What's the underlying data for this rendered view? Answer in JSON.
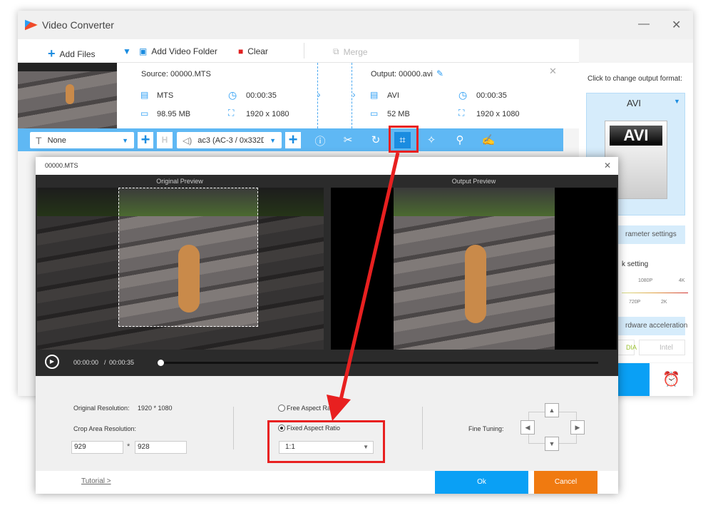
{
  "app": {
    "title": "Video Converter"
  },
  "toolbar": {
    "add_files": "Add Files",
    "add_folder": "Add Video Folder",
    "clear": "Clear",
    "merge": "Merge"
  },
  "file": {
    "source_label": "Source: 00000.MTS",
    "src_format": "MTS",
    "src_duration": "00:00:35",
    "src_size": "98.95 MB",
    "src_resolution": "1920 x 1080",
    "output_label": "Output: 00000.avi",
    "out_format": "AVI",
    "out_duration": "00:00:35",
    "out_size": "52 MB",
    "out_resolution": "1920 x 1080"
  },
  "edit_bar": {
    "subtitle": "None",
    "audio": "ac3 (AC-3 / 0x332D·",
    "tools": [
      "info-icon",
      "scissors-icon",
      "rotate-icon",
      "crop-icon",
      "effects-icon",
      "watermark-icon",
      "edit-icon"
    ]
  },
  "right_panel": {
    "prompt": "Click to change output format:",
    "format": "AVI",
    "format_icon_text": "AVI",
    "param_btn": "rameter settings",
    "quality_label": "k setting",
    "ticks_top": [
      "1080P",
      "4K"
    ],
    "ticks_bottom": [
      "720P",
      "2K"
    ],
    "hw_btn": "rdware acceleration",
    "nvidia": "DIA",
    "intel": "Intel"
  },
  "dialog": {
    "title": "00000.MTS",
    "original_preview": "Original Preview",
    "output_preview": "Output Preview",
    "time_current": "00:00:00",
    "time_sep": "/",
    "time_total": "00:00:35",
    "progress": 0,
    "orig_res_label": "Original Resolution:",
    "orig_res_value": "1920 * 1080",
    "crop_res_label": "Crop Area Resolution:",
    "crop_w": "929",
    "crop_sep": "*",
    "crop_h": "928",
    "free_ratio": "Free Aspect Ratio",
    "fixed_ratio": "Fixed Aspect Ratio",
    "ratio_value": "1:1",
    "selected_ratio_mode": "fixed",
    "fine_tuning": "Fine Tuning:",
    "tutorial": "Tutorial >",
    "ok": "Ok",
    "cancel": "Cancel"
  },
  "colors": {
    "accent": "#5fb8f4",
    "ok": "#0aa0f5",
    "cancel": "#f07a10",
    "highlight": "#e82020"
  }
}
